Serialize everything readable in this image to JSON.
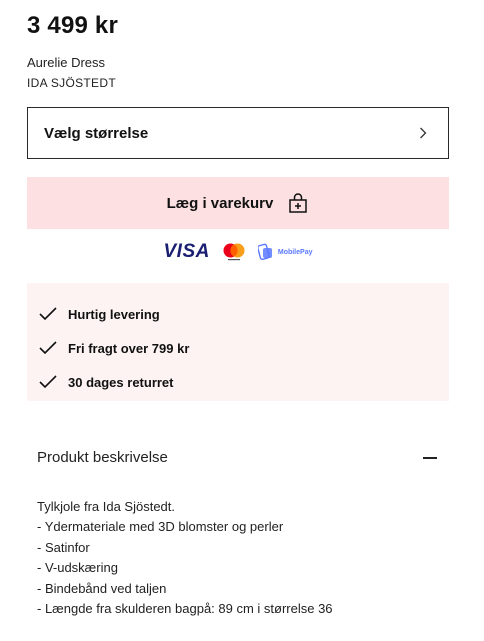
{
  "product": {
    "price": "3 499 kr",
    "name": "Aurelie Dress",
    "brand": "IDA SJÖSTEDT"
  },
  "size_selector": {
    "label": "Vælg størrelse"
  },
  "cart_button": {
    "label": "Læg i varekurv"
  },
  "payments": {
    "visa": "VISA",
    "mobilepay": "MobilePay"
  },
  "benefits": [
    {
      "label": "Hurtig levering"
    },
    {
      "label": "Fri fragt over 799 kr"
    },
    {
      "label": "30 dages returret"
    }
  ],
  "description": {
    "title": "Produkt beskrivelse",
    "lines": [
      "Tylkjole fra Ida Sjöstedt.",
      "- Ydermateriale med 3D blomster og perler",
      "- Satinfor",
      "- V-udskæring",
      "- Bindebånd ved taljen",
      "- Længde fra skulderen bagpå: 89 cm i størrelse 36"
    ]
  },
  "colors": {
    "cart_bg": "#fde0e2",
    "benefits_bg": "#fcf3f2",
    "visa": "#1a1f71",
    "mobilepay": "#5a78ff"
  }
}
